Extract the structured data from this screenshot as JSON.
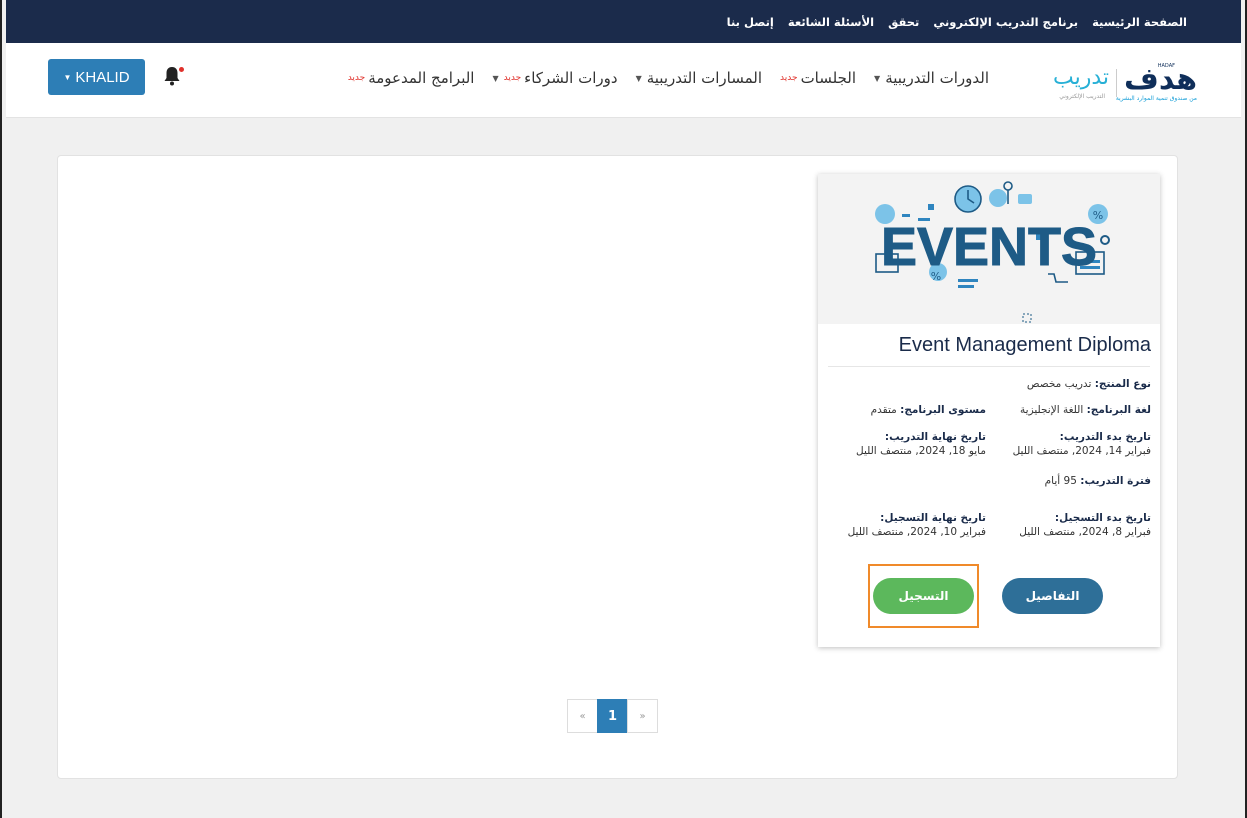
{
  "topbar": {
    "links": [
      "الصفحة الرئيسية",
      "برنامج التدريب الإلكتروني",
      "تحقق",
      "الأسئلة الشائعة",
      "إتصل بنا"
    ]
  },
  "logo": {
    "brand": "هدف",
    "brand_tag": "HADAF",
    "brand_sub": "من صندوق تنمية الموارد البشرية",
    "product": "تدريب",
    "product_sub": "التدريب الإلكتروني"
  },
  "nav": {
    "items": [
      {
        "label": "الدورات التدريبية",
        "badge": "",
        "has_caret": true
      },
      {
        "label": "الجلسات",
        "badge": "جديد",
        "has_caret": false
      },
      {
        "label": "المسارات التدريبية",
        "badge": "",
        "has_caret": true
      },
      {
        "label": "دورات الشركاء",
        "badge": "جديد",
        "has_caret": true
      },
      {
        "label": "البرامج المدعومة",
        "badge": "جديد",
        "has_caret": false
      }
    ]
  },
  "user": {
    "name": "KHALID",
    "notification_dot": true
  },
  "card": {
    "image_text": "EVENTS",
    "title": "Event Management Diploma",
    "product_type_label": "نوع المنتج:",
    "product_type_value": "تدريب مخصص",
    "language_label": "لغة البرنامج:",
    "language_value": "اللغة الإنجليزية",
    "level_label": "مستوى البرنامج:",
    "level_value": "متقدم",
    "train_start_label": "تاريخ بدء التدريب:",
    "train_start_value": "فبراير 14, 2024, منتصف الليل",
    "train_end_label": "تاريخ نهاية التدريب:",
    "train_end_value": "مايو 18, 2024, منتصف الليل",
    "duration_label": "فترة التدريب:",
    "duration_value": "95 أيام",
    "reg_start_label": "تاريخ بدء التسجيل:",
    "reg_start_value": "فبراير 8, 2024, منتصف الليل",
    "reg_end_label": "تاريخ نهاية التسجيل:",
    "reg_end_value": "فبراير 10, 2024, منتصف الليل",
    "details_button": "التفاصيل",
    "register_button": "التسجيل"
  },
  "pagination": {
    "prev": "«",
    "current": "1",
    "next": "»"
  },
  "colors": {
    "topbar": "#1b2b4b",
    "primary": "#2d7eb6",
    "details": "#2e6f98",
    "register": "#5cb85c",
    "highlight": "#f08a2a",
    "badge": "#e0312b"
  }
}
